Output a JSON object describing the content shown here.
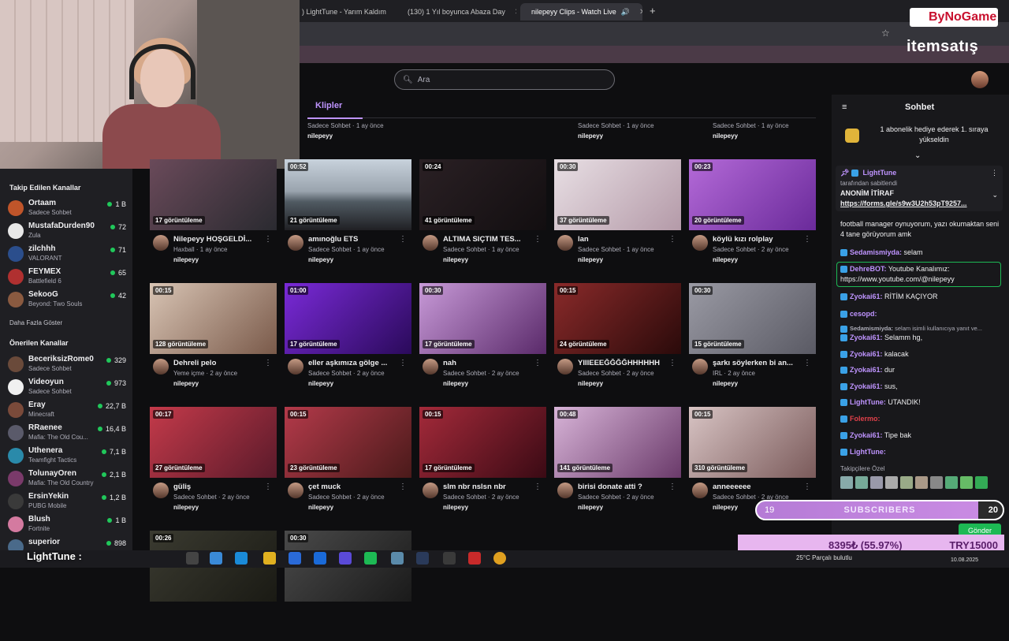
{
  "browser": {
    "tabs": [
      {
        "title": ") LightTune - Yarım Kaldım",
        "active": false
      },
      {
        "title": "(130) 1 Yıl boyunca Abaza Day",
        "active": false
      },
      {
        "title": "nilepeyy Clips - Watch Live",
        "active": true
      }
    ],
    "new_tab": "+"
  },
  "search": {
    "placeholder": "Ara"
  },
  "tabs": {
    "clips": "Klipler"
  },
  "sidebar": {
    "followed_title": "Takip Edilen Kanallar",
    "followed": [
      {
        "name": "Ortaam",
        "game": "Sadece Sohbet",
        "viewers": "1 B",
        "color": "#c0552a"
      },
      {
        "name": "MustafaDurden90",
        "game": "Zula",
        "viewers": "72",
        "color": "#e8e8e8"
      },
      {
        "name": "zilchhh",
        "game": "VALORANT",
        "viewers": "71",
        "color": "#2b4e8c"
      },
      {
        "name": "FEYMEX",
        "game": "Battlefield 6",
        "viewers": "65",
        "color": "#b03030"
      },
      {
        "name": "SekooG",
        "game": "Beyond: Two Souls",
        "viewers": "42",
        "color": "#8a5a40"
      }
    ],
    "show_more": "Daha Fazla Göster",
    "recommended_title": "Önerilen Kanallar",
    "recommended": [
      {
        "name": "BeceriksizRome0",
        "game": "Sadece Sohbet",
        "viewers": "329",
        "color": "#6a4a3a"
      },
      {
        "name": "Videoyun",
        "game": "Sadece Sohbet",
        "viewers": "973",
        "color": "#f0f0f0"
      },
      {
        "name": "Eray",
        "game": "Minecraft",
        "viewers": "22,7 B",
        "color": "#7a4a3a"
      },
      {
        "name": "RRaenee",
        "game": "Mafia: The Old Cou...",
        "viewers": "16,4 B",
        "color": "#5a5a6a"
      },
      {
        "name": "Uthenera",
        "game": "Teamfight Tactics",
        "viewers": "7,1 B",
        "color": "#2a8aaa"
      },
      {
        "name": "TolunayOren",
        "game": "Mafia: The Old Country",
        "viewers": "2,1 B",
        "color": "#7a3a6a"
      },
      {
        "name": "ErsinYekin",
        "game": "PUBG Mobile",
        "viewers": "1,2 B",
        "color": "#3a3a3a"
      },
      {
        "name": "Blush",
        "game": "Fortnite",
        "viewers": "1 B",
        "color": "#d47aa0"
      },
      {
        "name": "superior",
        "game": "",
        "viewers": "898",
        "color": "#4a6a8a"
      }
    ]
  },
  "top_row": [
    {
      "meta": "Sadece Sohbet · 1 ay önce",
      "user": "nilepeyy"
    },
    {
      "meta": "Sadece Sohbet · 1 ay önce",
      "user": "nilepeyy"
    },
    {
      "meta": "Sadece Sohbet · 1 ay önce",
      "user": "nilepeyy"
    }
  ],
  "clips": [
    {
      "dur": "",
      "views": "17 görüntüleme",
      "title": "Nilepeyy HOŞGELDİ...",
      "meta": "Haxball · 1 ay önce",
      "user": "nilepeyy",
      "bg": "linear-gradient(135deg,#6a4a5a,#2a2a30)"
    },
    {
      "dur": "00:52",
      "views": "21 görüntüleme",
      "title": "amınoğlu ETS",
      "meta": "Sadece Sohbet · 1 ay önce",
      "user": "nilepeyy",
      "bg": "linear-gradient(180deg,#c8d2dc 0%,#9aa4ae 45%,#505a62 60%,#202024 100%)"
    },
    {
      "dur": "00:24",
      "views": "41 görüntüleme",
      "title": "ALTIMA SIÇTIM TES...",
      "meta": "Sadece Sohbet · 1 ay önce",
      "user": "nilepeyy",
      "bg": "linear-gradient(135deg,#2a2024,#120e10)"
    },
    {
      "dur": "00:30",
      "views": "37 görüntüleme",
      "title": "lan",
      "meta": "Sadece Sohbet · 1 ay önce",
      "user": "nilepeyy",
      "bg": "linear-gradient(135deg,#e8dfe4,#b49aa8)"
    },
    {
      "dur": "00:23",
      "views": "20 görüntüleme",
      "title": "köylü kızı rolplay",
      "meta": "Sadece Sohbet · 2 ay önce",
      "user": "nilepeyy",
      "bg": "linear-gradient(135deg,#b46ad8,#6a2a9a)"
    },
    {
      "dur": "00:15",
      "views": "128 görüntüleme",
      "title": "Dehreli pelo",
      "meta": "Yeme içme · 2 ay önce",
      "user": "nilepeyy",
      "bg": "linear-gradient(135deg,#d8c4b4,#7a5a4a)"
    },
    {
      "dur": "01:00",
      "views": "17 görüntüleme",
      "title": "eller aşkımıza gölge ...",
      "meta": "Sadece Sohbet · 2 ay önce",
      "user": "nilepeyy",
      "bg": "linear-gradient(135deg,#7a2ad8,#2a0a5a)"
    },
    {
      "dur": "00:30",
      "views": "17 görüntüleme",
      "title": "nah",
      "meta": "Sadece Sohbet · 2 ay önce",
      "user": "nilepeyy",
      "bg": "linear-gradient(135deg,#c89ad8,#5a2a6a)"
    },
    {
      "dur": "00:15",
      "views": "24 görüntüleme",
      "title": "YIIIEEEĞĞĞĞHHHHHH",
      "meta": "Sadece Sohbet · 2 ay önce",
      "user": "nilepeyy",
      "bg": "linear-gradient(135deg,#8a2a2a,#2a0a0a)"
    },
    {
      "dur": "00:30",
      "views": "15 görüntüleme",
      "title": "şarkı söylerken bi an...",
      "meta": "IRL · 2 ay önce",
      "user": "nilepeyy",
      "bg": "linear-gradient(135deg,#9a9aa4,#5a5a64)"
    },
    {
      "dur": "00:17",
      "views": "27 görüntüleme",
      "title": "güliş",
      "meta": "Sadece Sohbet · 2 ay önce",
      "user": "nilepeyy",
      "bg": "linear-gradient(135deg,#c43a4a,#5a1a2a)"
    },
    {
      "dur": "00:15",
      "views": "23 görüntüleme",
      "title": "çet muck",
      "meta": "Sadece Sohbet · 2 ay önce",
      "user": "nilepeyy",
      "bg": "linear-gradient(135deg,#b43a4a,#4a1a1a)"
    },
    {
      "dur": "00:15",
      "views": "17 görüntüleme",
      "title": "slm nbr nslsn nbr",
      "meta": "Sadece Sohbet · 2 ay önce",
      "user": "nilepeyy",
      "bg": "linear-gradient(135deg,#a42a3a,#3a0a14)"
    },
    {
      "dur": "00:48",
      "views": "141 görüntüleme",
      "title": "birisi donate atti ?",
      "meta": "Sadece Sohbet · 2 ay önce",
      "user": "nilepeyy",
      "bg": "linear-gradient(135deg,#d8b4d8,#6a3a6a)"
    },
    {
      "dur": "00:15",
      "views": "310 görüntüleme",
      "title": "anneeeeee",
      "meta": "Sadece Sohbet · 2 ay önce",
      "user": "nilepeyy",
      "bg": "linear-gradient(135deg,#d8c4c4,#7a5a5a)"
    },
    {
      "dur": "00:26",
      "views": "",
      "title": "",
      "meta": "",
      "user": "",
      "bg": "linear-gradient(135deg,#3a3a30,#1a1a14)"
    },
    {
      "dur": "00:30",
      "views": "",
      "title": "",
      "meta": "",
      "user": "",
      "bg": "linear-gradient(135deg,#4a4a4a,#1a1a1a)"
    }
  ],
  "chat": {
    "title": "Sohbet",
    "gift_text": "1 abonelik hediye ederek 1. sıraya yükseldin",
    "pinned": {
      "user": "LightTune",
      "by": "tarafından sabitlendi",
      "title": "ANONİM İTİRAF",
      "link": "https://forms.gle/s9w3U2h53pT9257..."
    },
    "messages": [
      {
        "user": "",
        "text": "football manager oynuyorum, yazı okumaktan seni 4 tane görüyorum amk",
        "color": "#efeff1"
      },
      {
        "user": "Sedamismiyda:",
        "text": "selam",
        "color": "#bf94ff"
      },
      {
        "user": "DehreBOT:",
        "text": "Youtube Kanalımız: https://www.youtube.com/@nilepeyy",
        "color": "#bf94ff"
      },
      {
        "user": "Zyokai61:",
        "text": "RİTİM KAÇIYOR",
        "color": "#bf94ff"
      },
      {
        "user": "cesopd:",
        "text": "",
        "color": "#bf94ff"
      },
      {
        "user": "Sedamismiyda:",
        "text": "selam isimli kullanıcıya yanıt ve...",
        "color": "#adadb8"
      },
      {
        "user": "Zyokai61:",
        "text": "Selamm hg,",
        "color": "#bf94ff"
      },
      {
        "user": "Zyokai61:",
        "text": "kalacak",
        "color": "#bf94ff"
      },
      {
        "user": "Zyokai61:",
        "text": "dur",
        "color": "#bf94ff"
      },
      {
        "user": "Zyokai61:",
        "text": "sus,",
        "color": "#bf94ff"
      },
      {
        "user": "LightTune:",
        "text": "UTANDIK!",
        "color": "#bf94ff"
      },
      {
        "user": "Folermo:",
        "text": "",
        "color": "#e0404a"
      },
      {
        "user": "Zyokai61:",
        "text": "Tipe bak",
        "color": "#bf94ff"
      },
      {
        "user": "LightTune:",
        "text": "",
        "color": "#bf94ff"
      }
    ],
    "followers_only": "Takipçilere Özel",
    "send": "Gönder"
  },
  "overlay": {
    "sub_count": "19",
    "sub_label": "SUBSCRIBERS",
    "sub_goal": "20",
    "donation": "8395₺ (55.97%)",
    "donation_goal": "TRY15000",
    "streamer": "LightTune :",
    "brand1": "ByNoGame",
    "brand2": "itemsatış"
  },
  "taskbar": {
    "weather": "25°C Parçalı bulutlu",
    "date": "10.08.2025"
  }
}
